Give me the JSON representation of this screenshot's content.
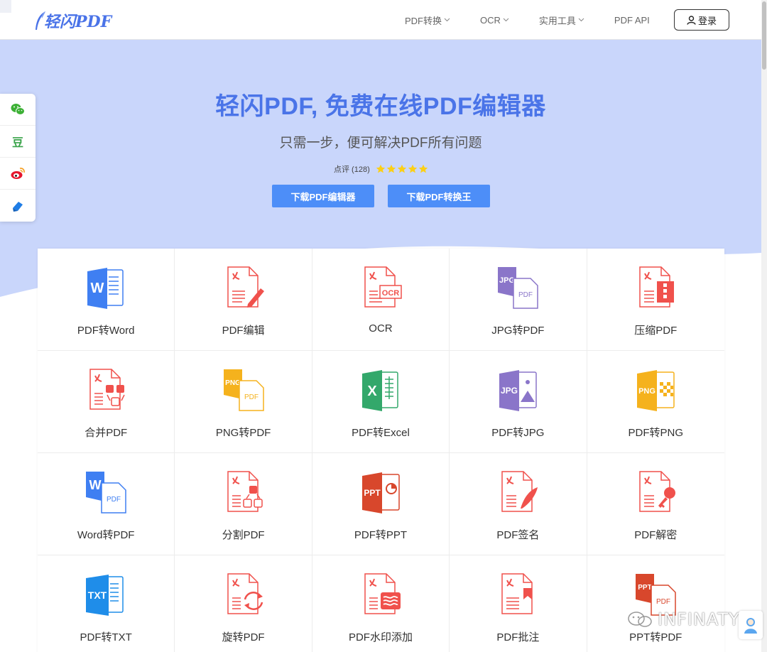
{
  "header": {
    "logo_text": "轻闪PDF",
    "nav": [
      {
        "label": "PDF转换"
      },
      {
        "label": "OCR"
      },
      {
        "label": "实用工具"
      },
      {
        "label": "PDF API"
      }
    ],
    "login_label": "登录"
  },
  "hero": {
    "title": "轻闪PDF, 免费在线PDF编辑器",
    "subtitle": "只需一步，便可解决PDF所有问题",
    "rating_text": "点评 (128)",
    "stars": 5,
    "download_editor": "下载PDF编辑器",
    "download_converter": "下载PDF转换王"
  },
  "social": [
    {
      "name": "wechat-icon"
    },
    {
      "name": "douban-icon",
      "label": "豆"
    },
    {
      "name": "weibo-icon"
    },
    {
      "name": "share-icon"
    }
  ],
  "tools": [
    {
      "label": "PDF转Word",
      "icon": "word-icon"
    },
    {
      "label": "PDF编辑",
      "icon": "pdf-edit-icon"
    },
    {
      "label": "OCR",
      "icon": "ocr-icon"
    },
    {
      "label": "JPG转PDF",
      "icon": "jpg-to-pdf-icon"
    },
    {
      "label": "压缩PDF",
      "icon": "compress-pdf-icon"
    },
    {
      "label": "合并PDF",
      "icon": "merge-pdf-icon"
    },
    {
      "label": "PNG转PDF",
      "icon": "png-to-pdf-icon"
    },
    {
      "label": "PDF转Excel",
      "icon": "excel-icon"
    },
    {
      "label": "PDF转JPG",
      "icon": "jpg-icon"
    },
    {
      "label": "PDF转PNG",
      "icon": "png-icon"
    },
    {
      "label": "Word转PDF",
      "icon": "word-to-pdf-icon"
    },
    {
      "label": "分割PDF",
      "icon": "split-pdf-icon"
    },
    {
      "label": "PDF转PPT",
      "icon": "ppt-icon"
    },
    {
      "label": "PDF签名",
      "icon": "sign-pdf-icon"
    },
    {
      "label": "PDF解密",
      "icon": "unlock-pdf-icon"
    },
    {
      "label": "PDF转TXT",
      "icon": "txt-icon"
    },
    {
      "label": "旋转PDF",
      "icon": "rotate-pdf-icon"
    },
    {
      "label": "PDF水印添加",
      "icon": "watermark-pdf-icon"
    },
    {
      "label": "PDF批注",
      "icon": "annotate-pdf-icon"
    },
    {
      "label": "PPT转PDF",
      "icon": "ppt-to-pdf-icon"
    }
  ],
  "icon_text": {
    "word": "W",
    "ocr": "OCR",
    "jpg": "JPG",
    "pdf": "PDF",
    "png": "PNG",
    "excel": "X",
    "ppt": "PPT",
    "txt": "TXT"
  },
  "watermark": "INFINATY",
  "colors": {
    "accent": "#4a74e8",
    "button": "#4d8ef8",
    "hero_bg": "#c9d6fb",
    "pdf_red": "#f0514c",
    "word_blue": "#3f7ff2",
    "excel_green": "#33a86b",
    "jpg_purple": "#8a75c9",
    "png_yellow": "#f5b21d",
    "ppt_red": "#d8472c",
    "txt_blue": "#1f8de9"
  }
}
